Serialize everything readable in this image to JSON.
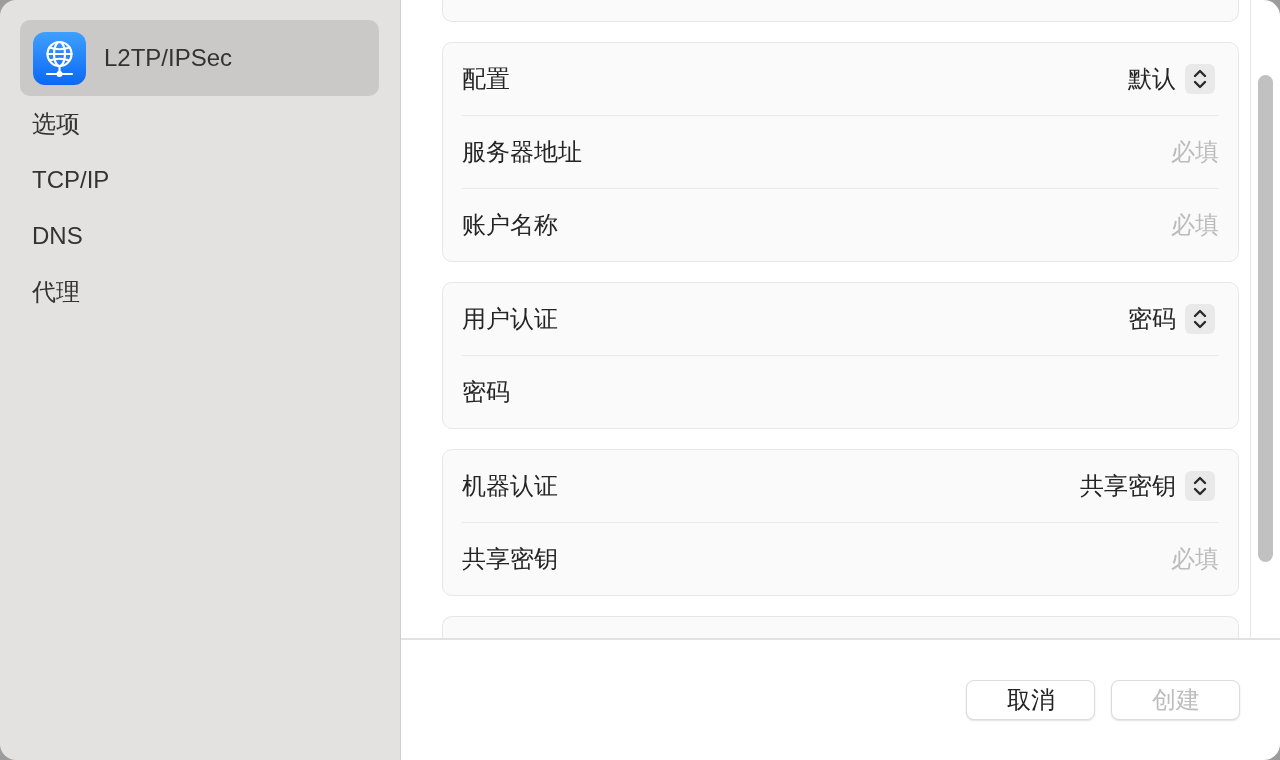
{
  "sidebar": {
    "items": [
      {
        "label": "L2TP/IPSec",
        "kind": "service",
        "selected": true
      },
      {
        "label": "选项",
        "kind": "section",
        "selected": false
      },
      {
        "label": "TCP/IP",
        "kind": "section",
        "selected": false
      },
      {
        "label": "DNS",
        "kind": "section",
        "selected": false
      },
      {
        "label": "代理",
        "kind": "section",
        "selected": false
      }
    ]
  },
  "form": {
    "groups": [
      {
        "rows": [
          {
            "kind": "popup",
            "label": "配置",
            "value": "默认"
          },
          {
            "kind": "field",
            "label": "服务器地址",
            "placeholder": "必填"
          },
          {
            "kind": "field",
            "label": "账户名称",
            "placeholder": "必填"
          }
        ]
      },
      {
        "rows": [
          {
            "kind": "popup",
            "label": "用户认证",
            "value": "密码"
          },
          {
            "kind": "field",
            "label": "密码"
          }
        ]
      },
      {
        "rows": [
          {
            "kind": "popup",
            "label": "机器认证",
            "value": "共享密钥"
          },
          {
            "kind": "field",
            "label": "共享密钥",
            "placeholder": "必填"
          }
        ]
      }
    ]
  },
  "buttons": [
    {
      "label": "取消",
      "disabled": false
    },
    {
      "label": "创建",
      "disabled": true
    }
  ]
}
